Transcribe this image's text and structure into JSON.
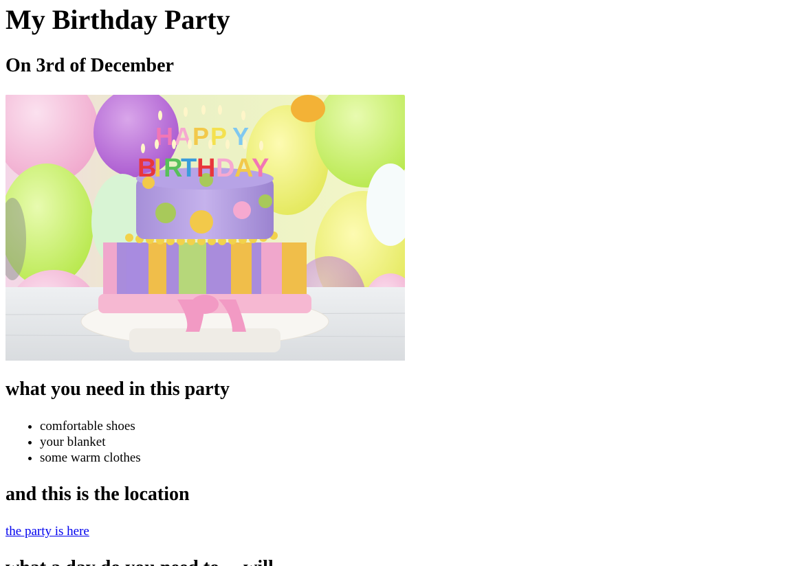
{
  "page": {
    "title": "My Birthday Party",
    "date_heading": "On 3rd of December",
    "needs_heading": "what you need in this party",
    "needs_items": [
      {
        "label": "comfortable shoes"
      },
      {
        "label": "your blanket"
      },
      {
        "label": "some warm clothes"
      }
    ],
    "location_heading": "and this is the location",
    "location_link_text": "the party is here",
    "next_heading_partial": "what a day do you need to ... will"
  },
  "image": {
    "subject": "two-tier birthday cake with HAPPY BIRTHDAY candles and balloons",
    "cake_letters_top": "HAPPY",
    "cake_letters_bottom": "BIRTHDAY"
  },
  "colors": {
    "link": "#0000ee",
    "text": "#000000",
    "background": "#ffffff"
  }
}
